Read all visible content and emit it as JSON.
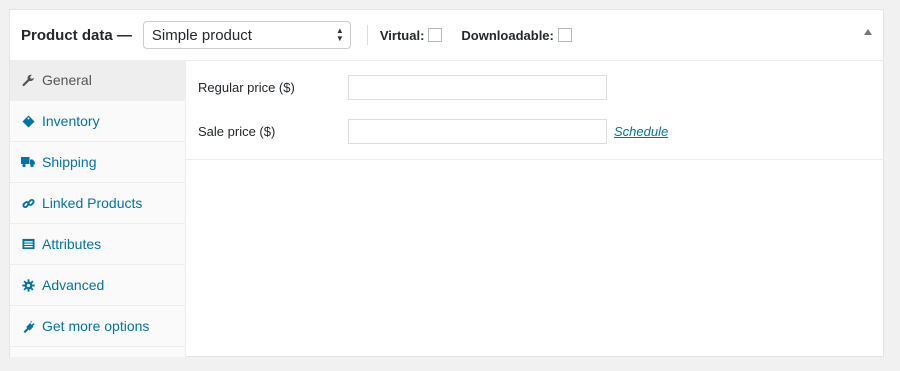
{
  "header": {
    "title": "Product data —",
    "product_type": "Simple product",
    "virtual_label": "Virtual:",
    "downloadable_label": "Downloadable:",
    "virtual_checked": false,
    "downloadable_checked": false
  },
  "tabs": [
    {
      "label": "General",
      "icon": "wrench-icon",
      "active": true
    },
    {
      "label": "Inventory",
      "icon": "tag-icon",
      "active": false
    },
    {
      "label": "Shipping",
      "icon": "truck-icon",
      "active": false
    },
    {
      "label": "Linked Products",
      "icon": "link-icon",
      "active": false
    },
    {
      "label": "Attributes",
      "icon": "list-icon",
      "active": false
    },
    {
      "label": "Advanced",
      "icon": "gear-icon",
      "active": false
    },
    {
      "label": "Get more options",
      "icon": "plugin-icon",
      "active": false
    }
  ],
  "general": {
    "regular_price_label": "Regular price ($)",
    "regular_price_value": "",
    "sale_price_label": "Sale price ($)",
    "sale_price_value": "",
    "schedule_link": "Schedule"
  },
  "colors": {
    "link": "#0073aa",
    "text": "#23282d",
    "background": "#f1f1f1"
  }
}
